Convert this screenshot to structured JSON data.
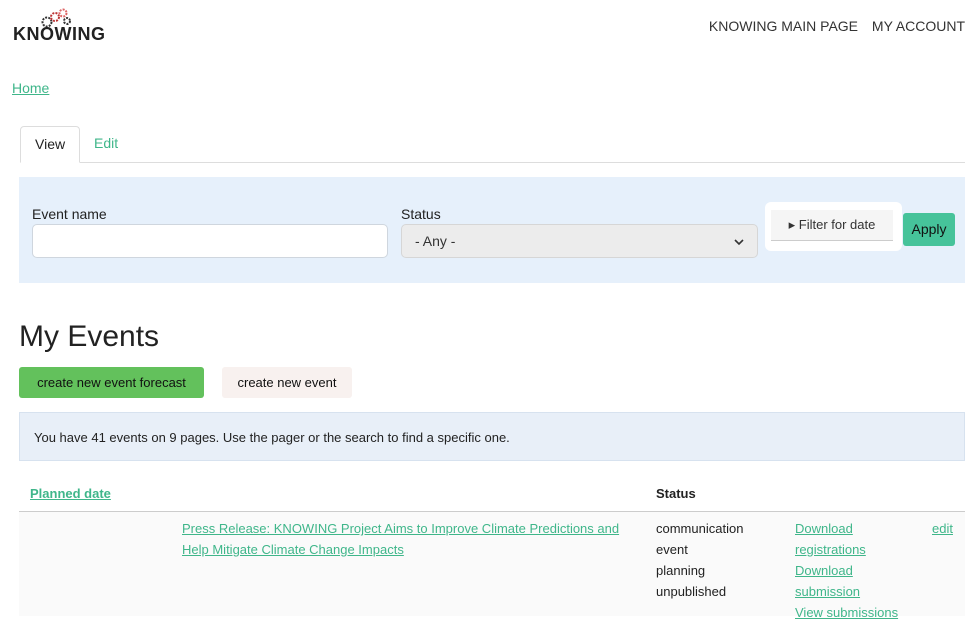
{
  "header": {
    "logo_text": "KNOWING",
    "nav": [
      "KNOWING MAIN PAGE",
      "MY ACCOUNT"
    ]
  },
  "breadcrumb": {
    "home": "Home"
  },
  "tabs": [
    {
      "label": "View",
      "active": true
    },
    {
      "label": "Edit",
      "active": false
    }
  ],
  "filters": {
    "event_name_label": "Event name",
    "event_name_value": "",
    "status_label": "Status",
    "status_selected": "- Any -",
    "date_filter_label": "▸ Filter for date",
    "apply_label": "Apply"
  },
  "page_title": "My Events",
  "buttons": {
    "forecast": "create new event forecast",
    "new_event": "create new event"
  },
  "info_message": "You have 41 events on 9 pages. Use the pager or the search to find a specific one.",
  "table": {
    "columns": {
      "planned_date": "Planned date",
      "status": "Status"
    },
    "rows": [
      {
        "title": "Press Release: KNOWING Project Aims to Improve Climate Predictions and Help Mitigate Climate Change Impacts",
        "status": [
          "communication",
          "event",
          "planning",
          "unpublished"
        ],
        "actions": [
          "Download registrations",
          "Download submission",
          "View submissions"
        ],
        "edit": "edit"
      }
    ]
  },
  "colors": {
    "accent": "#3fb68a",
    "filter_bg": "#e6f0fb",
    "forecast_btn": "#63c15c",
    "apply_btn": "#46c39a"
  }
}
